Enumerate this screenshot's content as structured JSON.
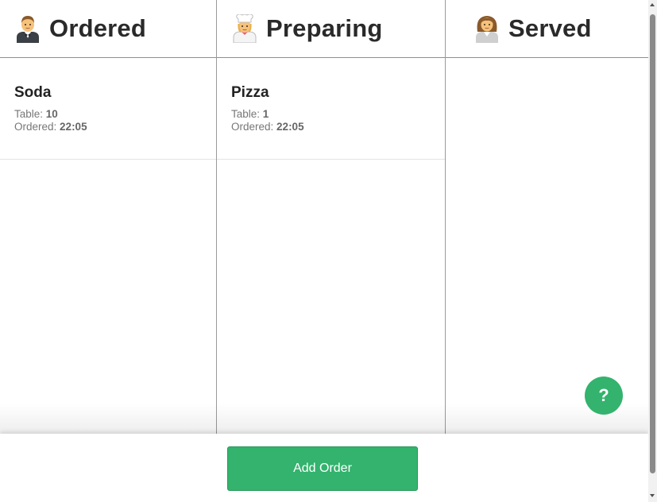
{
  "columns": [
    {
      "title": "Ordered",
      "icon": "waiter-emoji-icon",
      "cards": [
        {
          "item": "Soda",
          "table_label": "Table:",
          "table": "10",
          "ordered_label": "Ordered:",
          "time": "22:05"
        }
      ]
    },
    {
      "title": "Preparing",
      "icon": "cook-emoji-icon",
      "cards": [
        {
          "item": "Pizza",
          "table_label": "Table:",
          "table": "1",
          "ordered_label": "Ordered:",
          "time": "22:05"
        }
      ]
    },
    {
      "title": "Served",
      "icon": "customer-emoji-icon",
      "cards": []
    }
  ],
  "footer": {
    "add_order_label": "Add Order"
  },
  "help": {
    "label": "?"
  },
  "colors": {
    "accent": "#33b36d",
    "column_border": "#9a9a9a",
    "text": "#222222",
    "meta_text": "#777777"
  }
}
